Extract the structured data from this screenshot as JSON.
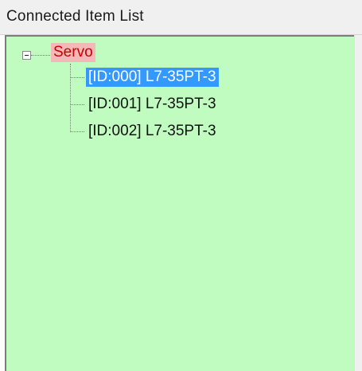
{
  "panel": {
    "title": "Connected Item List"
  },
  "tree": {
    "root": {
      "label": "Servo",
      "expanded": true,
      "highlight_color": "#f4b8b8",
      "text_color": "#cc0000"
    },
    "children": [
      {
        "label": "[ID:000] L7-35PT-3",
        "selected": true
      },
      {
        "label": "[ID:001] L7-35PT-3",
        "selected": false
      },
      {
        "label": "[ID:002] L7-35PT-3",
        "selected": false
      }
    ]
  },
  "colors": {
    "tree_background": "#c0fcc0",
    "selection": "#3399ff",
    "header_background": "#f0f0f0"
  }
}
